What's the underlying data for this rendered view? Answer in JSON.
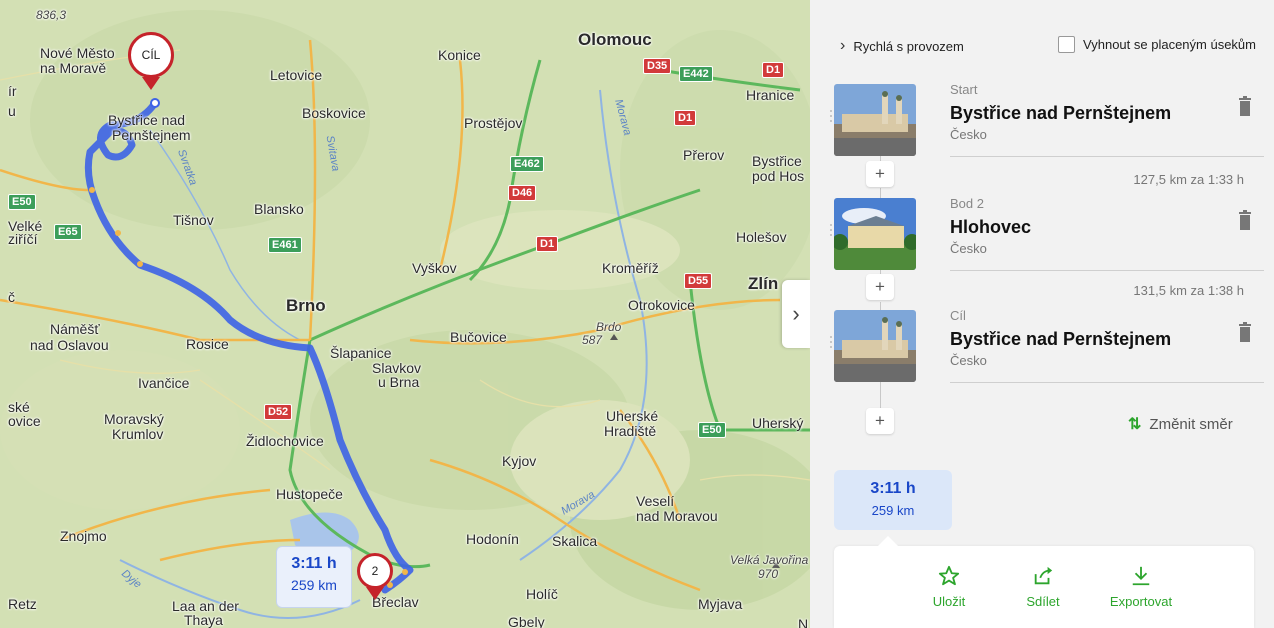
{
  "map": {
    "pins": {
      "destination_label": "CÍL",
      "waypoint_label": "2"
    },
    "route_bubble": {
      "time": "3:11 h",
      "distance": "259 km"
    },
    "labels": [
      {
        "text": "836,3",
        "cls": "it"
      },
      {
        "text": "Nové Město",
        "cls": ""
      },
      {
        "text": "na Moravě",
        "cls": ""
      },
      {
        "text": "Letovice",
        "cls": ""
      },
      {
        "text": "Konice",
        "cls": ""
      },
      {
        "text": "Olomouc",
        "cls": "big"
      },
      {
        "text": "Hranice",
        "cls": ""
      },
      {
        "text": "Bystřice nad",
        "cls": ""
      },
      {
        "text": "Pernštejnem",
        "cls": ""
      },
      {
        "text": "Boskovice",
        "cls": ""
      },
      {
        "text": "Prostějov",
        "cls": ""
      },
      {
        "text": "Přerov",
        "cls": ""
      },
      {
        "text": "Bystřice",
        "cls": ""
      },
      {
        "text": "pod Hos",
        "cls": ""
      },
      {
        "text": "Tišnov",
        "cls": ""
      },
      {
        "text": "Blansko",
        "cls": ""
      },
      {
        "text": "Velké",
        "cls": ""
      },
      {
        "text": "ziříčí",
        "cls": ""
      },
      {
        "text": "Holešov",
        "cls": ""
      },
      {
        "text": "Vyškov",
        "cls": ""
      },
      {
        "text": "Kroměříž",
        "cls": ""
      },
      {
        "text": "Zlín",
        "cls": "big"
      },
      {
        "text": "Brno",
        "cls": "big"
      },
      {
        "text": "Otrokovice",
        "cls": ""
      },
      {
        "text": "Náměšť",
        "cls": ""
      },
      {
        "text": "nad Oslavou",
        "cls": ""
      },
      {
        "text": "Rosice",
        "cls": ""
      },
      {
        "text": "Bučovice",
        "cls": ""
      },
      {
        "text": "Brdo",
        "cls": "it"
      },
      {
        "text": "587",
        "cls": "it"
      },
      {
        "text": "Šlapanice",
        "cls": ""
      },
      {
        "text": "Slavkov",
        "cls": ""
      },
      {
        "text": "u Brna",
        "cls": ""
      },
      {
        "text": "Ivančice",
        "cls": ""
      },
      {
        "text": "ské",
        "cls": ""
      },
      {
        "text": "ovice",
        "cls": ""
      },
      {
        "text": "Moravský",
        "cls": ""
      },
      {
        "text": "Krumlov",
        "cls": ""
      },
      {
        "text": "Židlochovice",
        "cls": ""
      },
      {
        "text": "Uherské",
        "cls": ""
      },
      {
        "text": "Hradiště",
        "cls": ""
      },
      {
        "text": "Uherský",
        "cls": ""
      },
      {
        "text": "Kyjov",
        "cls": ""
      },
      {
        "text": "Hustopeče",
        "cls": ""
      },
      {
        "text": "Veselí",
        "cls": ""
      },
      {
        "text": "nad Moravou",
        "cls": ""
      },
      {
        "text": "Znojmo",
        "cls": ""
      },
      {
        "text": "Hodonín",
        "cls": ""
      },
      {
        "text": "Skalica",
        "cls": ""
      },
      {
        "text": "Velká Javořina",
        "cls": "it"
      },
      {
        "text": "970",
        "cls": "it"
      },
      {
        "text": "Retz",
        "cls": ""
      },
      {
        "text": "Laa an der",
        "cls": ""
      },
      {
        "text": "Thaya",
        "cls": ""
      },
      {
        "text": "Holíč",
        "cls": ""
      },
      {
        "text": "Myjava",
        "cls": ""
      },
      {
        "text": "Břeclav",
        "cls": ""
      },
      {
        "text": "Gbely",
        "cls": ""
      },
      {
        "text": "Svratka",
        "cls": "river"
      },
      {
        "text": "Svitava",
        "cls": "river"
      },
      {
        "text": "Morava",
        "cls": "river"
      },
      {
        "text": "Morava",
        "cls": "river"
      },
      {
        "text": "Dyje",
        "cls": "river"
      },
      {
        "text": "N",
        "cls": ""
      },
      {
        "text": "č",
        "cls": ""
      },
      {
        "text": "ír",
        "cls": ""
      },
      {
        "text": "u",
        "cls": ""
      }
    ],
    "shields": [
      {
        "text": "D35",
        "kind": "d"
      },
      {
        "text": "E442",
        "kind": "e"
      },
      {
        "text": "D1",
        "kind": "d"
      },
      {
        "text": "D1",
        "kind": "d"
      },
      {
        "text": "E462",
        "kind": "e"
      },
      {
        "text": "D46",
        "kind": "d"
      },
      {
        "text": "E50",
        "kind": "e"
      },
      {
        "text": "E65",
        "kind": "e"
      },
      {
        "text": "E461",
        "kind": "e"
      },
      {
        "text": "D1",
        "kind": "d"
      },
      {
        "text": "D55",
        "kind": "d"
      },
      {
        "text": "D52",
        "kind": "d"
      },
      {
        "text": "E50",
        "kind": "e"
      }
    ]
  },
  "panel": {
    "route_option": "Rychlá s provozem",
    "avoid_tolls": "Vyhnout se placeným úsekům",
    "waypoints": [
      {
        "type": "Start",
        "name": "Bystřice nad Pernštejnem",
        "country": "Česko"
      },
      {
        "type": "Bod 2",
        "name": "Hlohovec",
        "country": "Česko"
      },
      {
        "type": "Cíl",
        "name": "Bystřice nad Pernštejnem",
        "country": "Česko"
      }
    ],
    "segments": [
      "127,5 km za 1:33 h",
      "131,5 km za 1:38 h"
    ],
    "reverse_label": "Změnit směr",
    "summary": {
      "time": "3:11 h",
      "distance": "259 km"
    },
    "actions": {
      "save": "Uložit",
      "share": "Sdílet",
      "export": "Exportovat"
    }
  },
  "colors": {
    "route": "#3d63e6",
    "accent_green": "#2da52d",
    "pin_red": "#c5232a",
    "highway": "#5cb85c"
  }
}
